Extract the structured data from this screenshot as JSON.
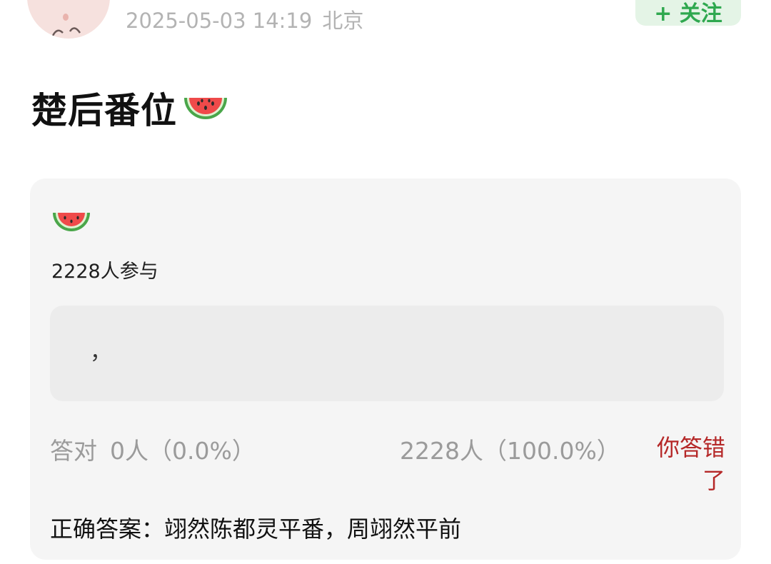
{
  "header": {
    "timestamp": "2025-05-03 14:19",
    "location": "北京",
    "follow_label": "+ 关注"
  },
  "post": {
    "title": "楚后番位",
    "title_emoji": "watermelon-icon"
  },
  "quiz": {
    "emoji": "watermelon-icon",
    "participants": "2228人参与",
    "answer_text": "，",
    "correct_label": "答对",
    "correct_stat": "0人（0.0%）",
    "wrong_stat": "2228人（100.0%）",
    "result_badge": "你答错了",
    "correct_answer": "正确答案：翊然陈都灵平番，周翊然平前"
  },
  "colors": {
    "accent_green": "#2fa84f",
    "error_red": "#b52828",
    "muted_gray": "#9b9b9b",
    "card_bg": "#f5f5f5"
  }
}
